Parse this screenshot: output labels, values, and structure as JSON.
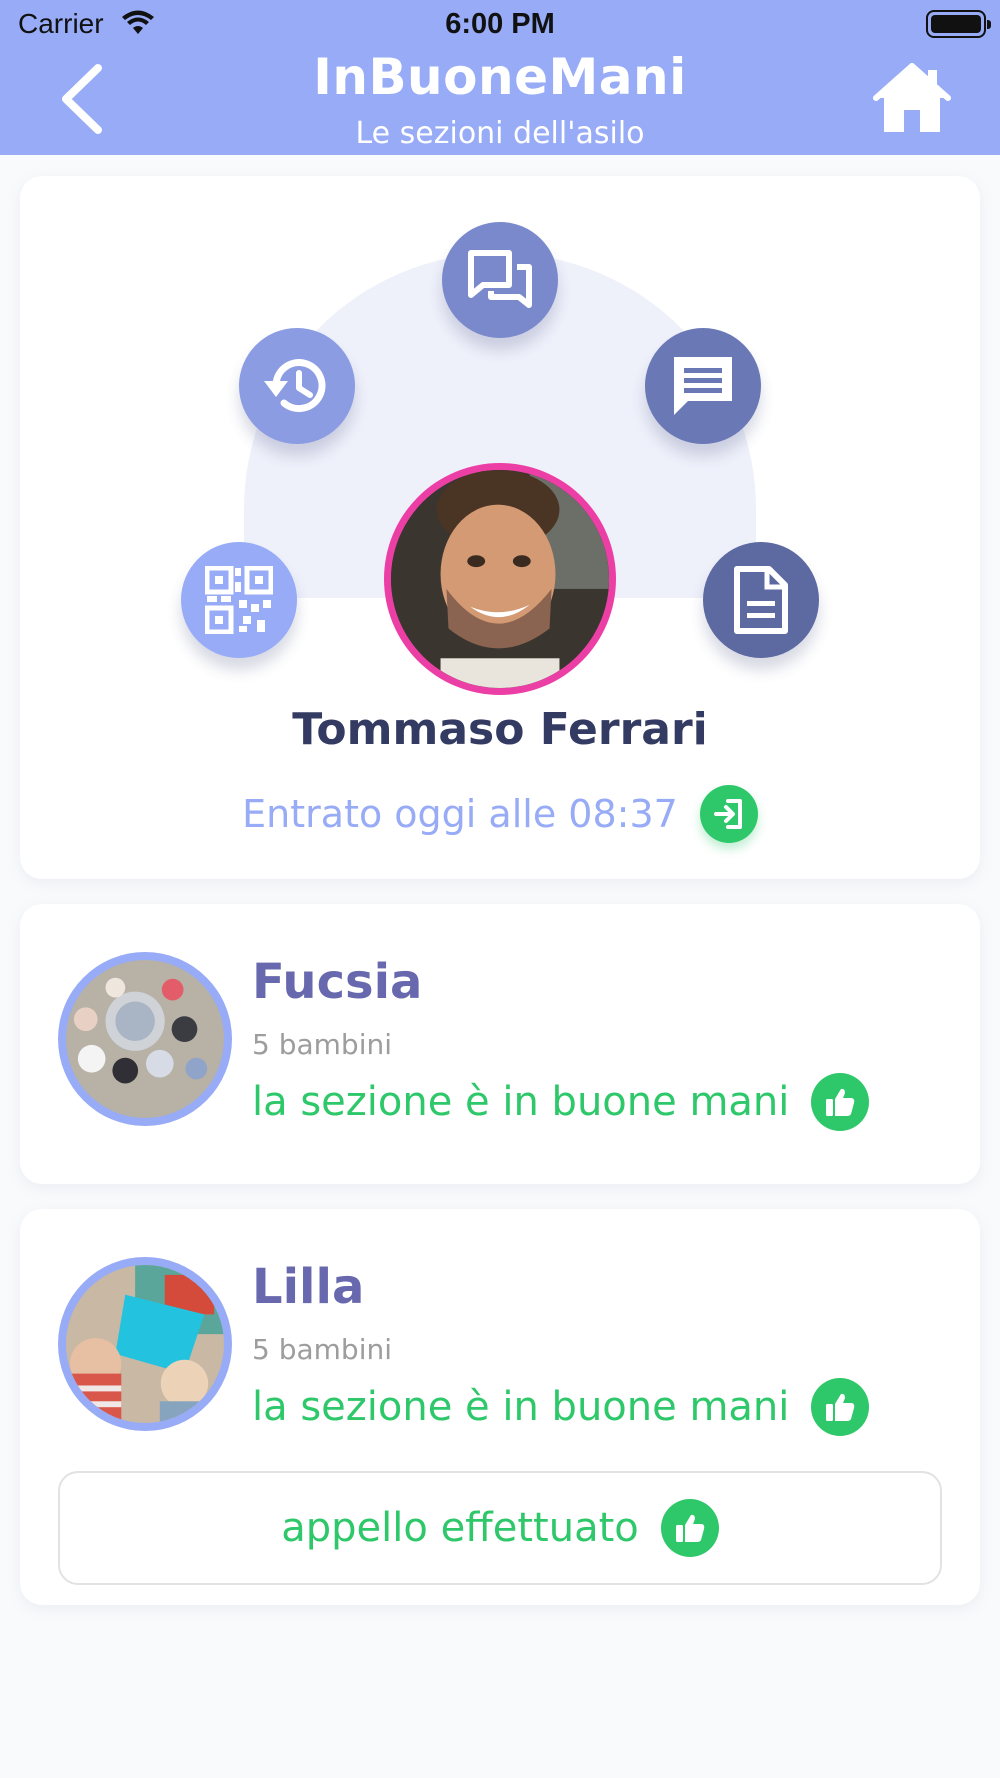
{
  "status_bar": {
    "carrier": "Carrier",
    "time": "6:00 PM"
  },
  "header": {
    "title": "InBuoneMani",
    "subtitle": "Le sezioni dell'asilo",
    "back_icon": "chevron-left-icon",
    "home_icon": "home-icon"
  },
  "profile": {
    "name": "Tommaso Ferrari",
    "entry_status": "Entrato oggi alle 08:37",
    "actions": [
      {
        "icon": "qr-code-icon",
        "color": "#97abf6"
      },
      {
        "icon": "history-icon",
        "color": "#8b9ce3"
      },
      {
        "icon": "chat-bubbles-icon",
        "color": "#7a89cc"
      },
      {
        "icon": "message-icon",
        "color": "#6a78b6"
      },
      {
        "icon": "document-icon",
        "color": "#5d6aa2"
      }
    ]
  },
  "sections": [
    {
      "name": "Fucsia",
      "children_count": "5 bambini",
      "status": "la sezione è in buone mani"
    },
    {
      "name": "Lilla",
      "children_count": "5 bambini",
      "status": "la sezione è in buone mani",
      "roll_call": "appello effettuato"
    }
  ],
  "colors": {
    "header": "#97abf6",
    "accent_green": "#2ec86a",
    "avatar_ring": "#ec3fa6",
    "section_name": "#6868ae",
    "person_name": "#343b62"
  }
}
